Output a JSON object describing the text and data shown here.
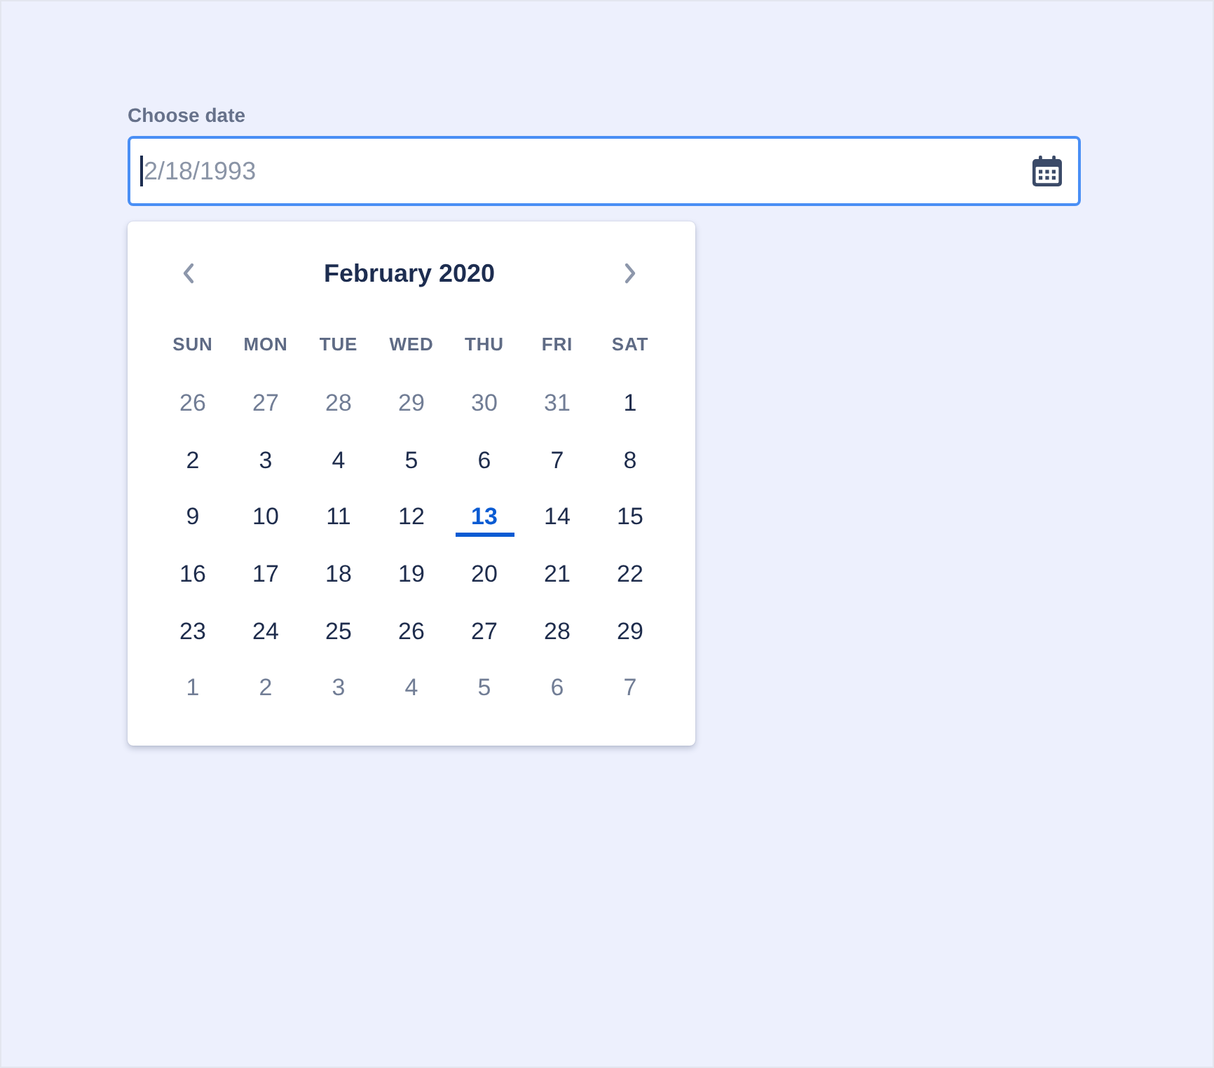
{
  "field": {
    "label": "Choose date",
    "placeholder": "2/18/1993",
    "focused": true
  },
  "calendar": {
    "month_title": "February 2020",
    "weekdays": [
      "SUN",
      "MON",
      "TUE",
      "WED",
      "THU",
      "FRI",
      "SAT"
    ],
    "weeks": [
      [
        {
          "day": "26",
          "outside": true,
          "selected": false
        },
        {
          "day": "27",
          "outside": true,
          "selected": false
        },
        {
          "day": "28",
          "outside": true,
          "selected": false
        },
        {
          "day": "29",
          "outside": true,
          "selected": false
        },
        {
          "day": "30",
          "outside": true,
          "selected": false
        },
        {
          "day": "31",
          "outside": true,
          "selected": false
        },
        {
          "day": "1",
          "outside": false,
          "selected": false
        }
      ],
      [
        {
          "day": "2",
          "outside": false,
          "selected": false
        },
        {
          "day": "3",
          "outside": false,
          "selected": false
        },
        {
          "day": "4",
          "outside": false,
          "selected": false
        },
        {
          "day": "5",
          "outside": false,
          "selected": false
        },
        {
          "day": "6",
          "outside": false,
          "selected": false
        },
        {
          "day": "7",
          "outside": false,
          "selected": false
        },
        {
          "day": "8",
          "outside": false,
          "selected": false
        }
      ],
      [
        {
          "day": "9",
          "outside": false,
          "selected": false
        },
        {
          "day": "10",
          "outside": false,
          "selected": false
        },
        {
          "day": "11",
          "outside": false,
          "selected": false
        },
        {
          "day": "12",
          "outside": false,
          "selected": false
        },
        {
          "day": "13",
          "outside": false,
          "selected": true
        },
        {
          "day": "14",
          "outside": false,
          "selected": false
        },
        {
          "day": "15",
          "outside": false,
          "selected": false
        }
      ],
      [
        {
          "day": "16",
          "outside": false,
          "selected": false
        },
        {
          "day": "17",
          "outside": false,
          "selected": false
        },
        {
          "day": "18",
          "outside": false,
          "selected": false
        },
        {
          "day": "19",
          "outside": false,
          "selected": false
        },
        {
          "day": "20",
          "outside": false,
          "selected": false
        },
        {
          "day": "21",
          "outside": false,
          "selected": false
        },
        {
          "day": "22",
          "outside": false,
          "selected": false
        }
      ],
      [
        {
          "day": "23",
          "outside": false,
          "selected": false
        },
        {
          "day": "24",
          "outside": false,
          "selected": false
        },
        {
          "day": "25",
          "outside": false,
          "selected": false
        },
        {
          "day": "26",
          "outside": false,
          "selected": false
        },
        {
          "day": "27",
          "outside": false,
          "selected": false
        },
        {
          "day": "28",
          "outside": false,
          "selected": false
        },
        {
          "day": "29",
          "outside": false,
          "selected": false
        }
      ],
      [
        {
          "day": "1",
          "outside": true,
          "selected": false
        },
        {
          "day": "2",
          "outside": true,
          "selected": false
        },
        {
          "day": "3",
          "outside": true,
          "selected": false
        },
        {
          "day": "4",
          "outside": true,
          "selected": false
        },
        {
          "day": "5",
          "outside": true,
          "selected": false
        },
        {
          "day": "6",
          "outside": true,
          "selected": false
        },
        {
          "day": "7",
          "outside": true,
          "selected": false
        }
      ]
    ]
  }
}
